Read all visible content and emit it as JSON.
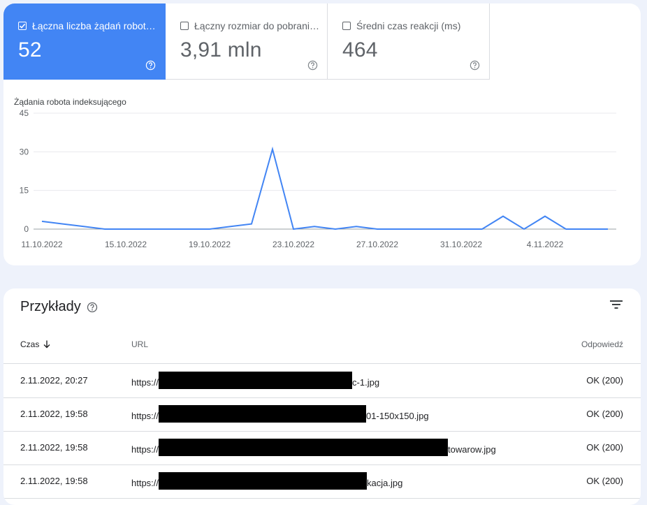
{
  "metrics": [
    {
      "label": "Łączna liczba żądań robot…",
      "value": "52",
      "checked": true
    },
    {
      "label": "Łączny rozmiar do pobrani…",
      "value": "3,91 mln",
      "checked": false
    },
    {
      "label": "Średni czas reakcji (ms)",
      "value": "464",
      "checked": false
    }
  ],
  "chart_data": {
    "type": "line",
    "title": "Żądania robota indeksującego",
    "ylim": [
      0,
      45
    ],
    "yticks": [
      "0",
      "15",
      "30",
      "45"
    ],
    "xticks": [
      "11.10.2022",
      "15.10.2022",
      "19.10.2022",
      "23.10.2022",
      "27.10.2022",
      "31.10.2022",
      "4.11.2022"
    ],
    "x": [
      "11.10.2022",
      "12.10.2022",
      "13.10.2022",
      "14.10.2022",
      "15.10.2022",
      "16.10.2022",
      "17.10.2022",
      "18.10.2022",
      "19.10.2022",
      "20.10.2022",
      "21.10.2022",
      "22.10.2022",
      "23.10.2022",
      "24.10.2022",
      "25.10.2022",
      "26.10.2022",
      "27.10.2022",
      "28.10.2022",
      "29.10.2022",
      "30.10.2022",
      "31.10.2022",
      "1.11.2022",
      "2.11.2022",
      "3.11.2022",
      "4.11.2022",
      "5.11.2022",
      "6.11.2022",
      "7.11.2022"
    ],
    "series": [
      {
        "values": [
          3,
          2,
          1,
          0,
          0,
          0,
          0,
          0,
          0,
          1,
          2,
          31,
          0,
          1,
          0,
          1,
          0,
          0,
          0,
          0,
          0,
          0,
          5,
          0,
          5,
          0,
          0,
          0
        ],
        "color": "#4285f4"
      }
    ],
    "grid": true
  },
  "examples": {
    "title": "Przykłady",
    "columns": {
      "time": "Czas",
      "url": "URL",
      "response": "Odpowiedź"
    },
    "rows": [
      {
        "time": "2.11.2022, 20:27",
        "url_prefix": "https://",
        "url_suffix": "c-1.jpg",
        "response": "OK (200)"
      },
      {
        "time": "2.11.2022, 19:58",
        "url_prefix": "https://",
        "url_suffix": "01-150x150.jpg",
        "response": "OK (200)"
      },
      {
        "time": "2.11.2022, 19:58",
        "url_prefix": "https://",
        "url_suffix": "towarow.jpg",
        "response": "OK (200)"
      },
      {
        "time": "2.11.2022, 19:58",
        "url_prefix": "https://",
        "url_suffix": "kacja.jpg",
        "response": "OK (200)"
      }
    ]
  },
  "colors": {
    "accent": "#4285f4",
    "line": "#4285f4",
    "grid": "#e8eaed"
  }
}
